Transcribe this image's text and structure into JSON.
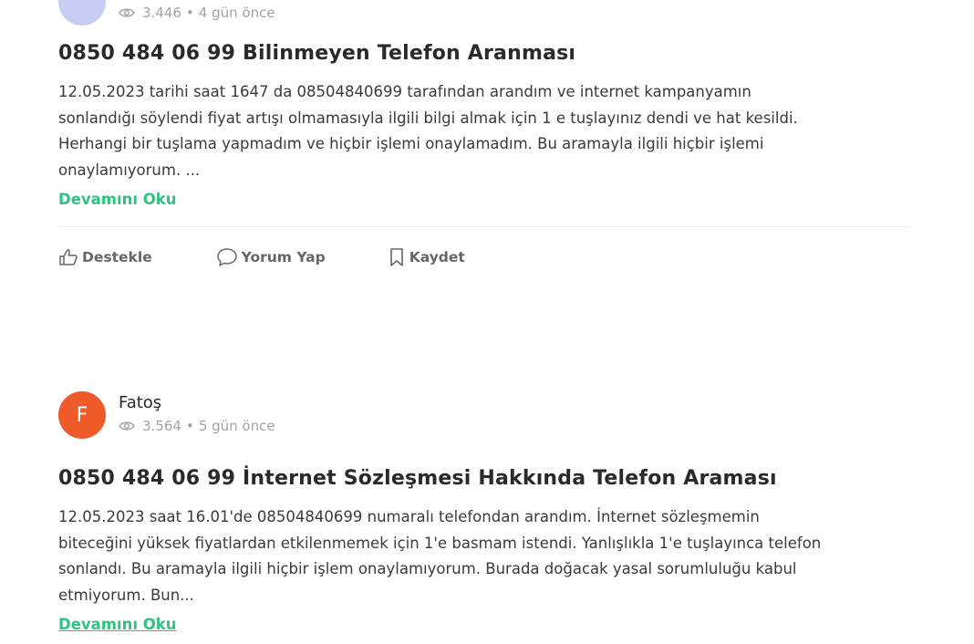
{
  "post1": {
    "stats": {
      "views": "3.446",
      "separator": "•",
      "time": "4 gün önce"
    },
    "title": "0850 484 06 99 Bilinmeyen Telefon Aranması",
    "body_lines": [
      "12.05.2023 tarihi saat 1647 da 08504840699 tarafından arandım ve internet kampanyamın",
      "sonlandığı söylendi fiyat artışı olmamasıyla ilgili bilgi almak için 1 e tuşlayınız dendi ve hat kesildi.",
      "Herhangi bir tuşlama yapmadım ve hiçbir işlemi onaylamadım. Bu aramayla ilgili hiçbir işlemi",
      "onaylamıyorum. ..."
    ],
    "read_more": "Devamını Oku",
    "actions": {
      "support": "Destekle",
      "comment": "Yorum Yap",
      "save": "Kaydet"
    }
  },
  "post2": {
    "author": {
      "initial": "F",
      "name": "Fatoş",
      "avatar_color": "#ef5a2a"
    },
    "stats": {
      "views": "3.564",
      "separator": "•",
      "time": "5 gün önce"
    },
    "title": "0850 484 06 99 İnternet Sözleşmesi Hakkında Telefon Araması",
    "body_lines": [
      "12.05.2023 saat 16.01'de 08504840699 numaralı telefondan arandım. İnternet sözleşmemin",
      "biteceğini yüksek fiyatlardan etkilenmemek için 1'e basmam istendi. Yanlışlıkla 1'e tuşlayınca telefon",
      "sonlandı. Bu aramayla ilgili hiçbir işlem onaylamıyorum. Burada doğacak yasal sorumluluğu kabul",
      "etmiyorum. Bun..."
    ],
    "read_more": "Devamını Oku"
  },
  "colors": {
    "accent_green": "#2fc37f",
    "avatar_partial": "#c7cdf2"
  },
  "icons": [
    "eye-icon",
    "thumbs-up-icon",
    "comment-icon",
    "bookmark-icon"
  ]
}
